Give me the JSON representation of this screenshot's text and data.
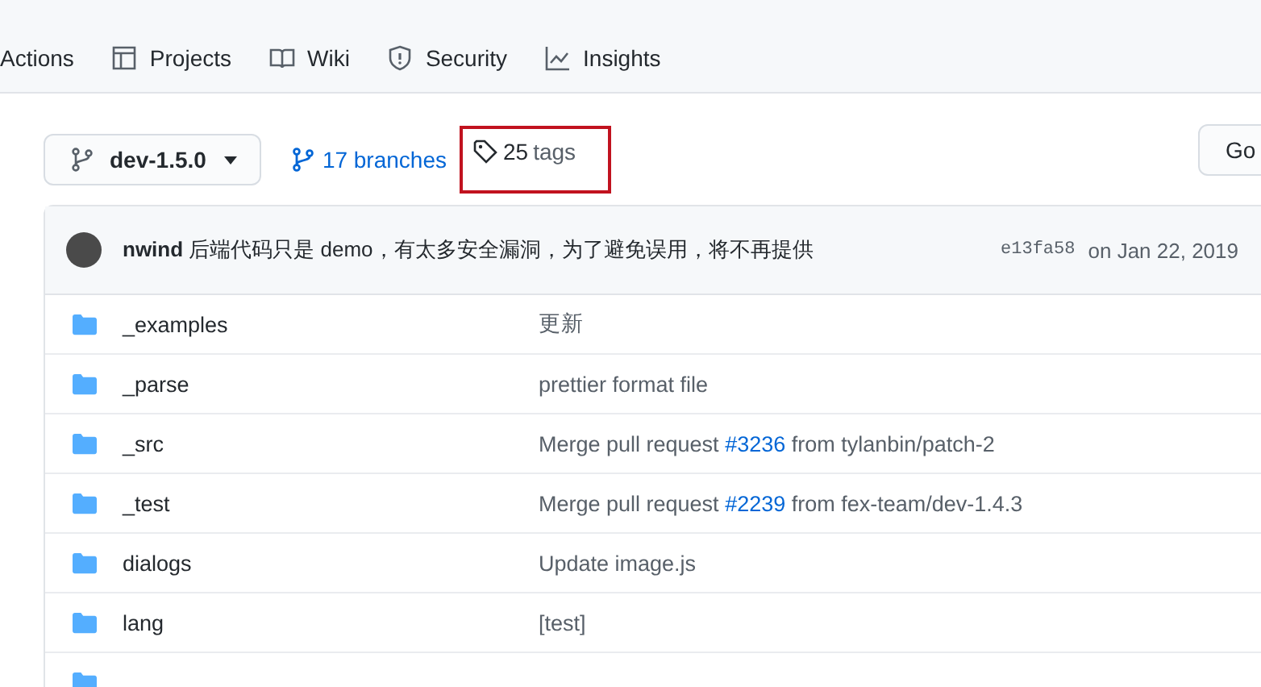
{
  "nav": {
    "items": [
      {
        "label": "Actions",
        "selected": false
      },
      {
        "label": "Projects",
        "selected": false
      },
      {
        "label": "Wiki",
        "selected": false
      },
      {
        "label": "Security",
        "selected": false
      },
      {
        "label": "Insights",
        "selected": false
      }
    ]
  },
  "branch_button": {
    "label": "dev-1.5.0"
  },
  "branches_link": {
    "label": "17 branches"
  },
  "tags_link": {
    "count": "25",
    "label": "tags",
    "highlighted": true
  },
  "go_button": {
    "label": "Go"
  },
  "latest_commit": {
    "author": "nwind",
    "message": "后端代码只是 demo，有太多安全漏洞，为了避免误用，将不再提供",
    "sha": "e13fa58",
    "date": "on Jan 22, 2019"
  },
  "files": [
    {
      "kind": "folder",
      "name": "_examples",
      "message": [
        {
          "kind": "text",
          "text": "更新"
        }
      ]
    },
    {
      "kind": "folder",
      "name": "_parse",
      "message": [
        {
          "kind": "text",
          "text": "prettier format file"
        }
      ]
    },
    {
      "kind": "folder",
      "name": "_src",
      "message": [
        {
          "kind": "text",
          "text": "Merge pull request "
        },
        {
          "kind": "link",
          "text": "#3236"
        },
        {
          "kind": "text",
          "text": " from tylanbin/patch-2"
        }
      ]
    },
    {
      "kind": "folder",
      "name": "_test",
      "message": [
        {
          "kind": "text",
          "text": "Merge pull request "
        },
        {
          "kind": "link",
          "text": "#2239"
        },
        {
          "kind": "text",
          "text": " from fex-team/dev-1.4.3"
        }
      ]
    },
    {
      "kind": "folder",
      "name": "dialogs",
      "message": [
        {
          "kind": "text",
          "text": "Update image.js"
        }
      ]
    },
    {
      "kind": "folder",
      "name": "lang",
      "message": [
        {
          "kind": "text",
          "text": "[test]"
        }
      ]
    },
    {
      "kind": "folder"
    }
  ]
}
